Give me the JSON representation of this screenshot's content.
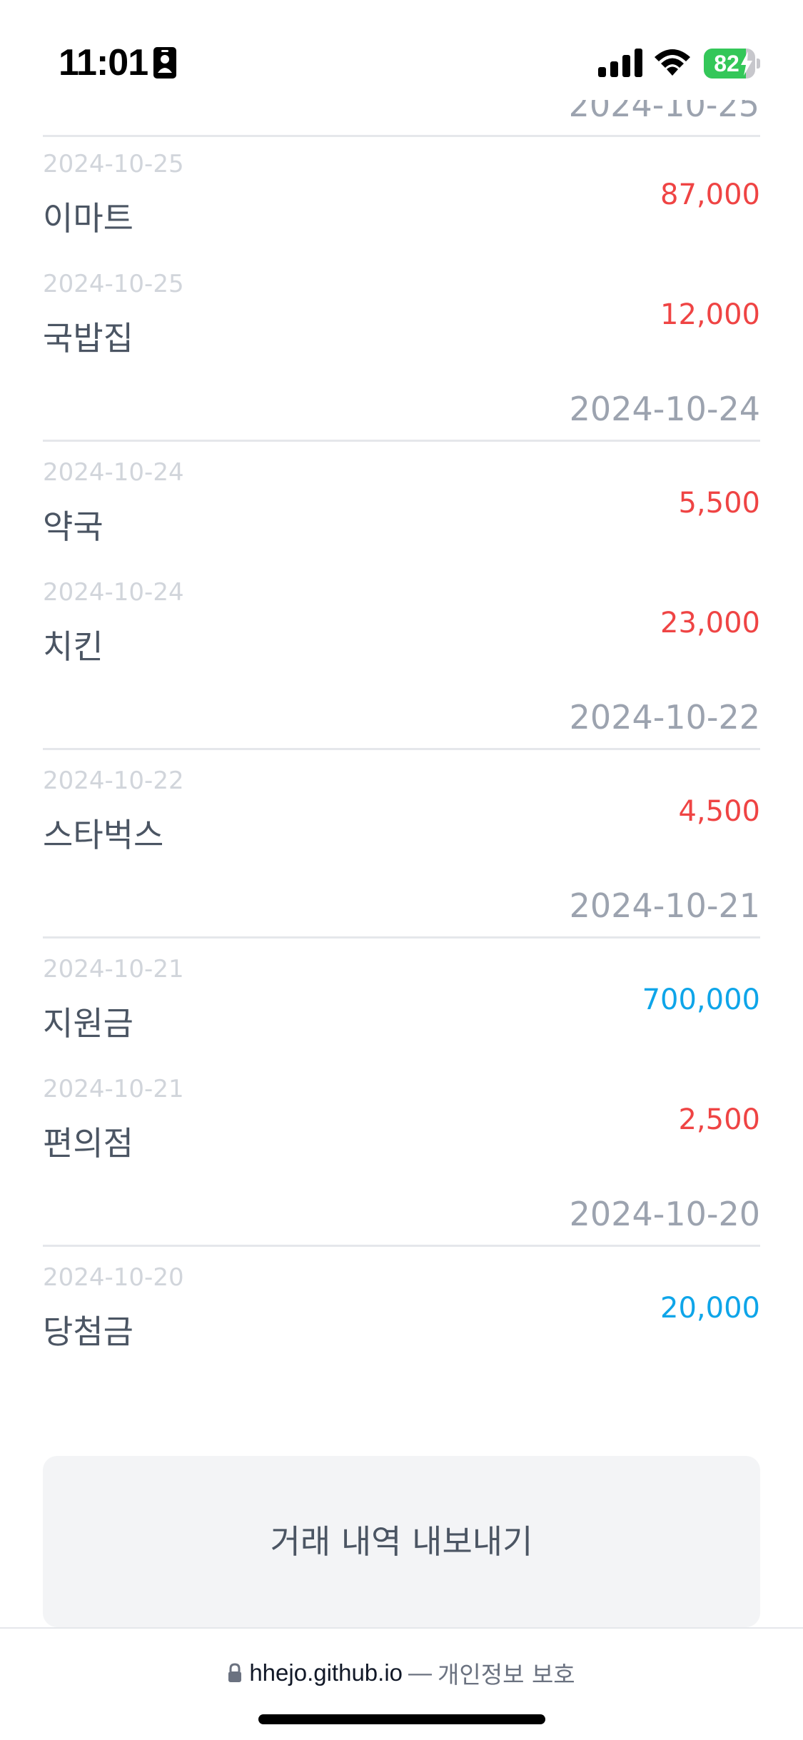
{
  "status_bar": {
    "time": "11:01",
    "battery_level": "82",
    "battery_fraction": 0.82,
    "icons": [
      "id-card-icon",
      "cellular-signal-icon",
      "wifi-icon",
      "battery-charging-icon"
    ]
  },
  "partial_header_date": "2024-10-25",
  "groups": [
    {
      "date": "2024-10-25",
      "transactions": [
        {
          "date": "2024-10-25",
          "name": "이마트",
          "amount": "87,000",
          "type": "expense"
        },
        {
          "date": "2024-10-25",
          "name": "국밥집",
          "amount": "12,000",
          "type": "expense"
        }
      ]
    },
    {
      "date": "2024-10-24",
      "transactions": [
        {
          "date": "2024-10-24",
          "name": "약국",
          "amount": "5,500",
          "type": "expense"
        },
        {
          "date": "2024-10-24",
          "name": "치킨",
          "amount": "23,000",
          "type": "expense"
        }
      ]
    },
    {
      "date": "2024-10-22",
      "transactions": [
        {
          "date": "2024-10-22",
          "name": "스타벅스",
          "amount": "4,500",
          "type": "expense"
        }
      ]
    },
    {
      "date": "2024-10-21",
      "transactions": [
        {
          "date": "2024-10-21",
          "name": "지원금",
          "amount": "700,000",
          "type": "income"
        },
        {
          "date": "2024-10-21",
          "name": "편의점",
          "amount": "2,500",
          "type": "expense"
        }
      ]
    },
    {
      "date": "2024-10-20",
      "transactions": [
        {
          "date": "2024-10-20",
          "name": "당첨금",
          "amount": "20,000",
          "type": "income"
        }
      ]
    }
  ],
  "export_button_label": "거래 내역 내보내기",
  "browser": {
    "domain": "hhejo.github.io",
    "separator": "—",
    "privacy_label": "개인정보 보호"
  },
  "colors": {
    "expense": "#ef4444",
    "income": "#0ea5e9",
    "text": "#4b5563",
    "muted": "#9ca3af",
    "faint": "#d1d5db",
    "button_bg": "#f3f4f6",
    "battery_green": "#34c759"
  }
}
